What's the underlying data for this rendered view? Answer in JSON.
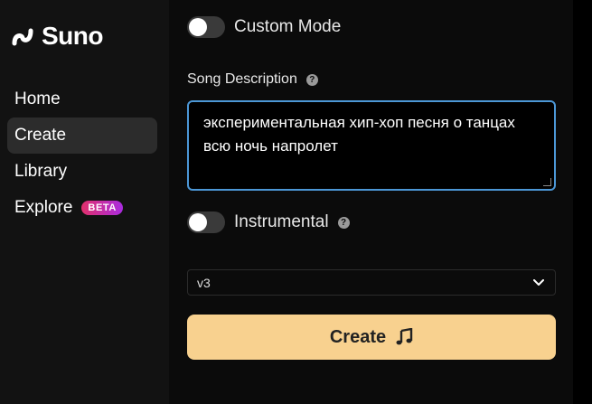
{
  "brand": {
    "name": "Suno"
  },
  "nav": {
    "items": [
      {
        "label": "Home"
      },
      {
        "label": "Create"
      },
      {
        "label": "Library"
      },
      {
        "label": "Explore",
        "badge": "BETA"
      }
    ],
    "active": "Create"
  },
  "form": {
    "custom_mode": {
      "label": "Custom Mode",
      "enabled": false
    },
    "song_description": {
      "label": "Song Description",
      "value": "экспериментальная хип-хоп песня о танцах всю ночь напролет"
    },
    "instrumental": {
      "label": "Instrumental",
      "enabled": false
    },
    "model": {
      "selected": "v3"
    },
    "create_label": "Create"
  },
  "icons": {
    "logo": "suno-wave-icon",
    "help": "question-circle-icon",
    "dropdown": "chevron-down-icon",
    "create": "music-note-icon"
  },
  "colors": {
    "accent": "#f8d18f",
    "focus_border": "#4c97d6",
    "badge_start": "#e1306c",
    "badge_end": "#a92be0"
  }
}
